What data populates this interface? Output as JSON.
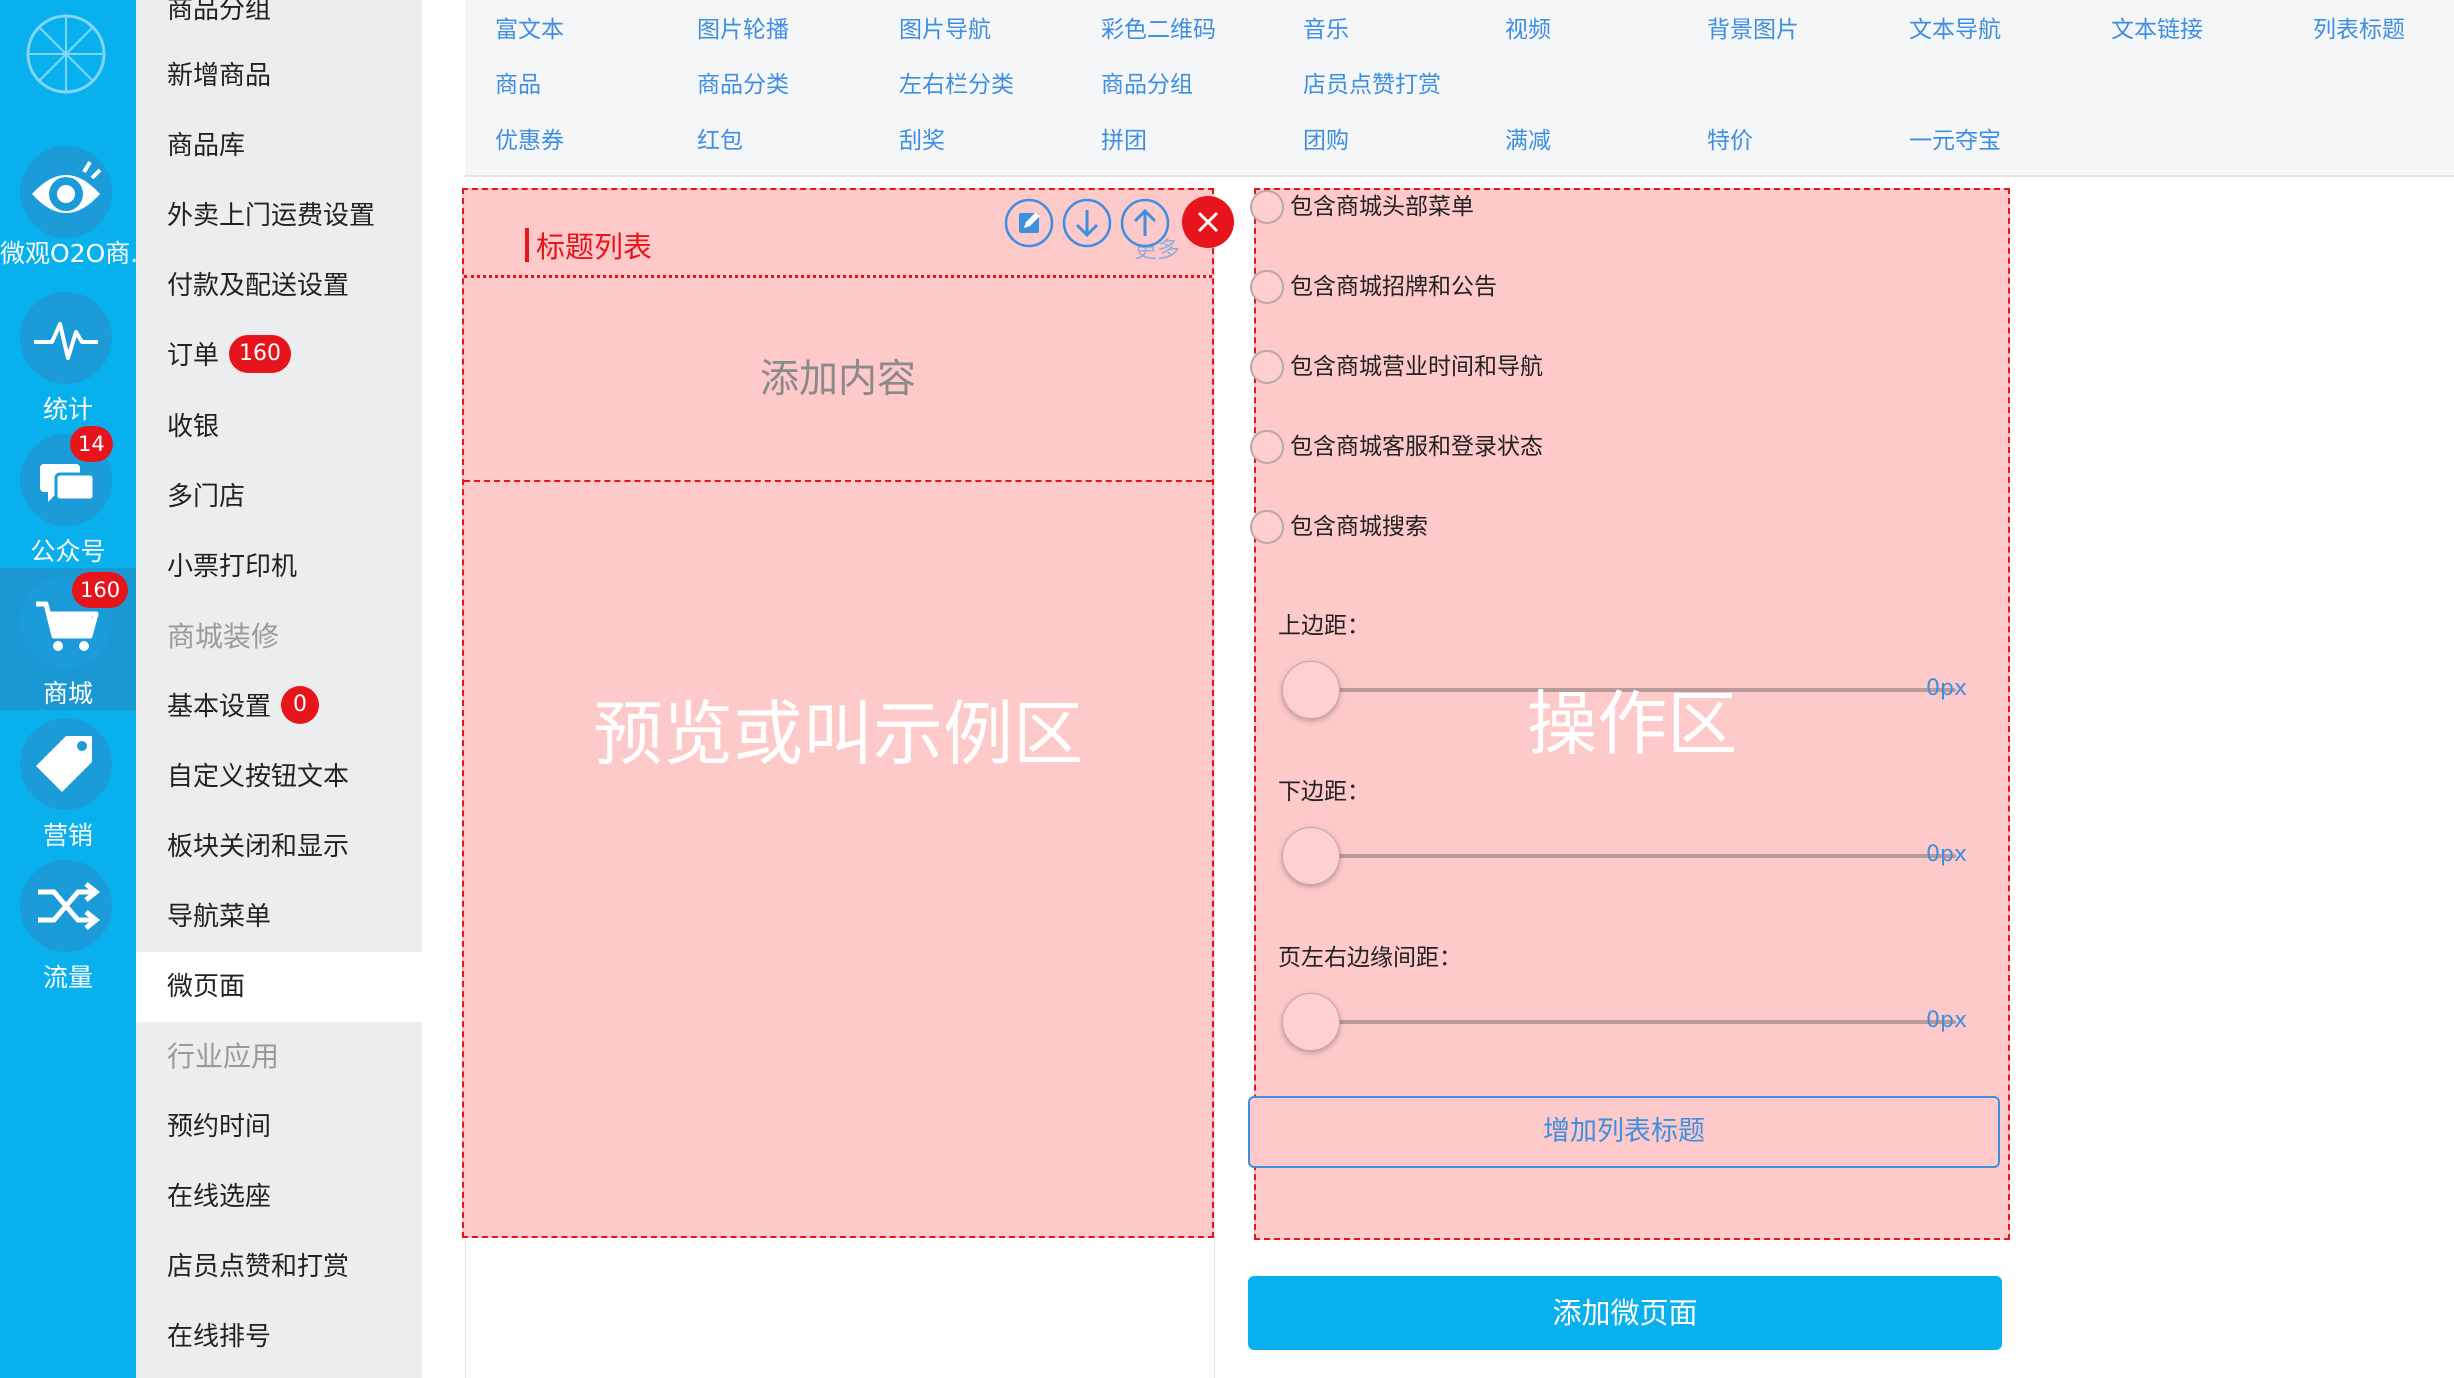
{
  "rail": {
    "items": [
      {
        "icon": "wheel-logo-icon",
        "label": ""
      },
      {
        "icon": "eye-icon",
        "label": "微观O2O商.."
      },
      {
        "icon": "pulse-icon",
        "label": "统计"
      },
      {
        "icon": "chat-icon",
        "label": "公众号",
        "badge": "14"
      },
      {
        "icon": "cart-icon",
        "label": "商城",
        "badge": "160"
      },
      {
        "icon": "tag-icon",
        "label": "营销"
      },
      {
        "icon": "shuffle-icon",
        "label": "流量"
      }
    ],
    "active_index": 4
  },
  "menu": {
    "items": [
      {
        "label": "商品分组"
      },
      {
        "label": "新增商品"
      },
      {
        "label": "商品库"
      },
      {
        "label": "外卖上门运费设置"
      },
      {
        "label": "付款及配送设置"
      },
      {
        "label": "订单",
        "badge": "160"
      },
      {
        "label": "收银"
      },
      {
        "label": "多门店"
      },
      {
        "label": "小票打印机"
      },
      {
        "label": "商城装修",
        "heading": true
      },
      {
        "label": "基本设置",
        "badge": "0"
      },
      {
        "label": "自定义按钮文本"
      },
      {
        "label": "板块关闭和显示"
      },
      {
        "label": "导航菜单"
      },
      {
        "label": "微页面",
        "active": true
      },
      {
        "label": "行业应用",
        "heading": true
      },
      {
        "label": "预约时间"
      },
      {
        "label": "在线选座"
      },
      {
        "label": "店员点赞和打赏"
      },
      {
        "label": "在线排号"
      }
    ]
  },
  "components": {
    "rows": [
      [
        "富文本",
        "图片轮播",
        "图片导航",
        "彩色二维码",
        "音乐",
        "视频",
        "背景图片",
        "文本导航",
        "文本链接",
        "列表标题"
      ],
      [
        "商品",
        "商品分类",
        "左右栏分类",
        "商品分组",
        "店员点赞打赏"
      ],
      [
        "优惠券",
        "红包",
        "刮奖",
        "拼团",
        "团购",
        "满减",
        "特价",
        "一元夺宝"
      ]
    ]
  },
  "preview": {
    "title": "标题列表",
    "more": "更多",
    "add_content": "添加内容",
    "area_label": "预览或叫示例区",
    "controls": [
      "edit-icon",
      "arrow-down-icon",
      "arrow-up-icon"
    ]
  },
  "ops": {
    "area_label": "操作区",
    "checkboxes": [
      {
        "label": "包含商城头部菜单",
        "checked": false
      },
      {
        "label": "包含商城招牌和公告",
        "checked": false
      },
      {
        "label": "包含商城营业时间和导航",
        "checked": false
      },
      {
        "label": "包含商城客服和登录状态",
        "checked": false
      },
      {
        "label": "包含商城搜索",
        "checked": false
      }
    ],
    "sliders": [
      {
        "label": "上边距：",
        "value_text": "0px",
        "value": 0
      },
      {
        "label": "下边距：",
        "value_text": "0px",
        "value": 0
      },
      {
        "label": "页左右边缘间距：",
        "value_text": "0px",
        "value": 0
      }
    ],
    "add_title_button": "增加列表标题"
  },
  "add_page_button": "添加微页面",
  "colors": {
    "rail_bg": "#08b0ee",
    "badge_red": "#e8141b",
    "link_blue": "#3f8fe0",
    "highlight_pink": "#fec9c9"
  }
}
